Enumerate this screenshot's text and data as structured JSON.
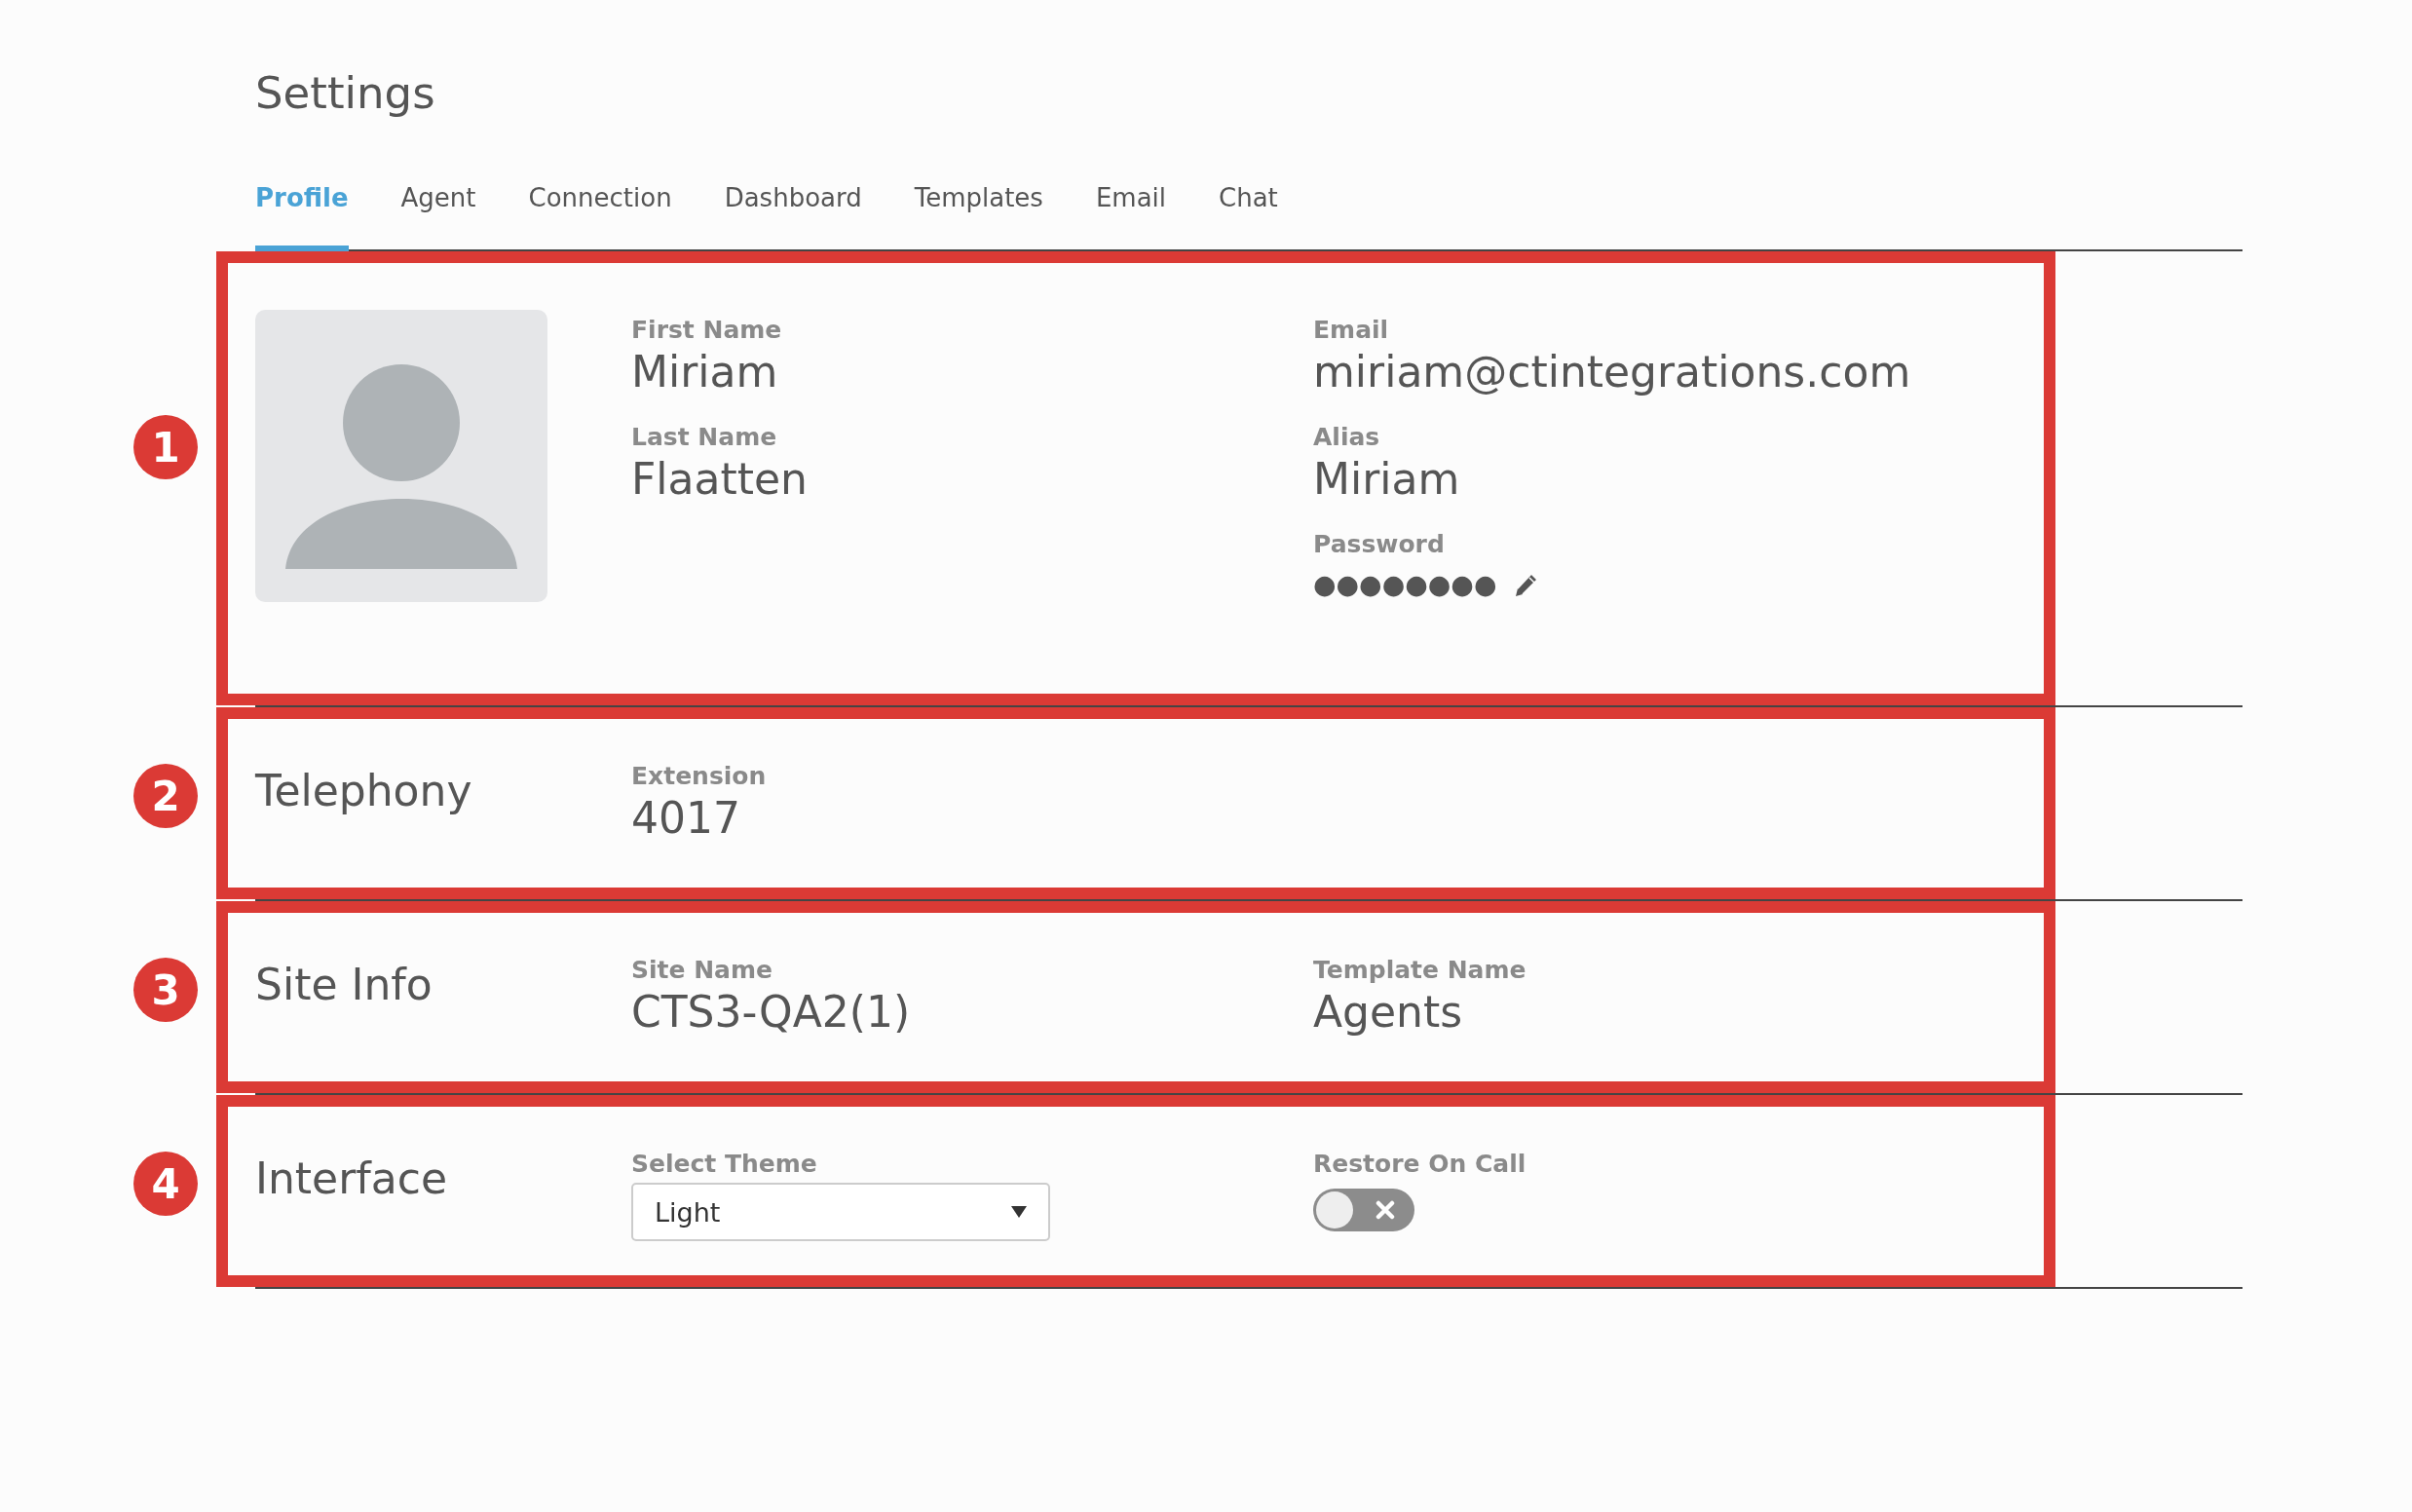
{
  "title": "Settings",
  "tabs": [
    {
      "label": "Profile",
      "selected": true
    },
    {
      "label": "Agent",
      "selected": false
    },
    {
      "label": "Connection",
      "selected": false
    },
    {
      "label": "Dashboard",
      "selected": false
    },
    {
      "label": "Templates",
      "selected": false
    },
    {
      "label": "Email",
      "selected": false
    },
    {
      "label": "Chat",
      "selected": false
    }
  ],
  "sections": [
    {
      "kind": "profile",
      "badge": "1",
      "columns": [
        [
          {
            "kind": "text",
            "label": "First Name",
            "value": "Miriam"
          },
          {
            "kind": "text",
            "label": "Last Name",
            "value": "Flaatten"
          }
        ],
        [
          {
            "kind": "text",
            "label": "Email",
            "value": "miriam@ctintegrations.com"
          },
          {
            "kind": "text",
            "label": "Alias",
            "value": "Miriam"
          },
          {
            "kind": "password",
            "label": "Password",
            "value": "●●●●●●●●"
          }
        ]
      ]
    },
    {
      "kind": "titled",
      "badge": "2",
      "title": "Telephony",
      "columns": [
        [
          {
            "kind": "text",
            "label": "Extension",
            "value": "4017"
          }
        ]
      ]
    },
    {
      "kind": "titled",
      "badge": "3",
      "title": "Site Info",
      "columns": [
        [
          {
            "kind": "text",
            "label": "Site Name",
            "value": "CTS3-QA2(1)"
          }
        ],
        [
          {
            "kind": "text",
            "label": "Template Name",
            "value": "Agents"
          }
        ]
      ]
    },
    {
      "kind": "titled",
      "badge": "4",
      "title": "Interface",
      "columns": [
        [
          {
            "kind": "select",
            "label": "Select Theme",
            "value": "Light"
          }
        ],
        [
          {
            "kind": "toggle",
            "label": "Restore On Call",
            "on": false
          }
        ]
      ]
    }
  ]
}
